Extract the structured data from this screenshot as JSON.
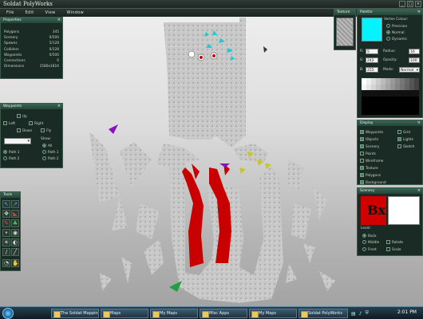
{
  "window": {
    "title": "Soldat PolyWorks"
  },
  "menu": [
    "File",
    "Edit",
    "View",
    "Window"
  ],
  "properties": {
    "title": "Properties",
    "rows": [
      {
        "label": "Polygons",
        "value": "345"
      },
      {
        "label": "Scenery",
        "value": "0/500"
      },
      {
        "label": "Spawns",
        "value": "5/128"
      },
      {
        "label": "Colliders",
        "value": "0/128"
      },
      {
        "label": "Waypoints",
        "value": "0/500"
      },
      {
        "label": "Connections",
        "value": "0"
      },
      {
        "label": "Dimensions",
        "value": "1580x1816"
      }
    ]
  },
  "waypoints": {
    "title": "Waypoints",
    "up": "Up",
    "left": "Left",
    "right": "Right",
    "down": "Down",
    "fly": "Fly",
    "show_label": "Show:",
    "all": "All",
    "path1": "Path 1",
    "path2": "Path 2",
    "path1_main": "Path 1",
    "path2_main": "Path 2"
  },
  "tools": {
    "title": "Tools"
  },
  "texture": {
    "title": "Texture"
  },
  "palette": {
    "title": "Palette",
    "vertex_colour": "Vertex Colour:",
    "precision": "Precision",
    "normal": "Normal",
    "dynamic": "Dynamic",
    "r_label": "R:",
    "r_value": "5",
    "g_label": "G:",
    "g_value": "242",
    "b_label": "B:",
    "b_value": "255",
    "radius_label": "Radius:",
    "radius_value": "16",
    "opacity_label": "Opacity:",
    "opacity_value": "100",
    "mode_label": "Mode:",
    "mode_value": "Normal",
    "swatch_color": "#05F2FF"
  },
  "display": {
    "title": "Display",
    "items_left": [
      "Waypoints",
      "Objects",
      "Scenery",
      "Points",
      "Wireframe",
      "Texture",
      "Polygons",
      "Background"
    ],
    "items_right": [
      "Grid",
      "Lights",
      "Sketch"
    ]
  },
  "scenery": {
    "title": "Scenery",
    "level_label": "Level:",
    "back": "Back",
    "middle": "Middle",
    "front": "Front",
    "rotate": "Rotate",
    "scale": "Scale"
  },
  "taskbar": {
    "tasks": [
      "The Soldat Mapping...",
      "Maps",
      "My Maps",
      "Misc Apps",
      "My Maps",
      "Soldat PolyWorks"
    ],
    "clock": "2:01 PM"
  }
}
